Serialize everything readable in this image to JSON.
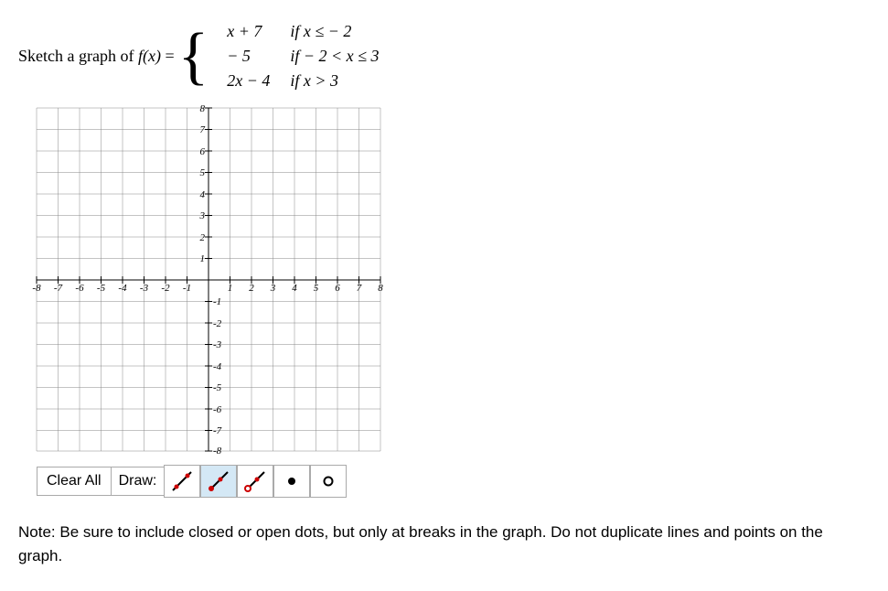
{
  "question": {
    "prompt_prefix": "Sketch a graph of ",
    "function_name": "f(x)",
    "equals": " = ",
    "pieces": [
      {
        "expr": "x + 7",
        "cond": "if   x ≤ − 2"
      },
      {
        "expr": "− 5",
        "cond": "if   − 2 < x ≤ 3"
      },
      {
        "expr": "2x − 4",
        "cond": "if   x > 3"
      }
    ]
  },
  "chart_data": {
    "type": "grid",
    "xlim": [
      -8,
      8
    ],
    "ylim": [
      -8,
      8
    ],
    "xticks": [
      -8,
      -7,
      -6,
      -5,
      -4,
      -3,
      -2,
      -1,
      1,
      2,
      3,
      4,
      5,
      6,
      7,
      8
    ],
    "yticks": [
      -8,
      -7,
      -6,
      -5,
      -4,
      -3,
      -2,
      -1,
      1,
      2,
      3,
      4,
      5,
      6,
      7,
      8
    ],
    "grid": true,
    "plotted": []
  },
  "toolbar": {
    "clear_label": "Clear All",
    "draw_label": "Draw:",
    "tools": [
      {
        "name": "line-tool",
        "selected": false
      },
      {
        "name": "ray-closed-tool",
        "selected": true
      },
      {
        "name": "ray-open-tool",
        "selected": false
      },
      {
        "name": "closed-dot-tool",
        "selected": false
      },
      {
        "name": "open-dot-tool",
        "selected": false
      }
    ]
  },
  "note": "Note: Be sure to include closed or open dots, but only at breaks in the graph. Do not duplicate lines and points on the graph."
}
